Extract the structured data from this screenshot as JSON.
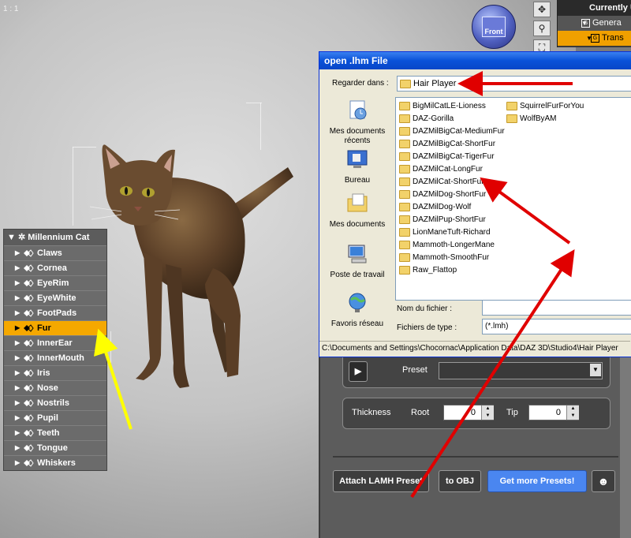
{
  "viewport": {
    "label": "1 : 1",
    "nav_cube_face": "Front"
  },
  "right_panel": {
    "header": "Currently U",
    "rows": [
      {
        "icon": "G",
        "label": "Genera"
      },
      {
        "icon": "G",
        "label": "Trans"
      }
    ]
  },
  "tree": {
    "root": "Millennium Cat",
    "selected": "Fur",
    "items": [
      "Claws",
      "Cornea",
      "EyeRim",
      "EyeWhite",
      "FootPads",
      "Fur",
      "InnerEar",
      "InnerMouth",
      "Iris",
      "Nose",
      "Nostrils",
      "Pupil",
      "Teeth",
      "Tongue",
      "Whiskers"
    ]
  },
  "dialog": {
    "title": "open .lhm File",
    "lookin_label": "Regarder dans :",
    "lookin_value": "Hair Player",
    "places": [
      "Mes documents récents",
      "Bureau",
      "Mes documents",
      "Poste de travail",
      "Favoris réseau"
    ],
    "files_col1": [
      "BigMilCatLE-Lioness",
      "DAZ-Gorilla",
      "DAZMilBigCat-MediumFur",
      "DAZMilBigCat-ShortFur",
      "DAZMilBigCat-TigerFur",
      "DAZMilCat-LongFur",
      "DAZMilCat-ShortFur",
      "DAZMilDog-ShortFur",
      "DAZMilDog-Wolf",
      "DAZMilPup-ShortFur",
      "LionManeTuft-Richard",
      "Mammoth-LongerMane",
      "Mammoth-SmoothFur",
      "Raw_Flattop"
    ],
    "files_col2": [
      "SquirrelFurForYou",
      "WolfByAM"
    ],
    "filename_label": "Nom du fichier :",
    "filename_value": "",
    "filetype_label": "Fichiers de type :",
    "filetype_value": "(*.lmh)",
    "status": "C:\\Documents and Settings\\Chocornac\\Application Data\\DAZ 3D\\Studio4\\Hair Player"
  },
  "hair_panel": {
    "preset_label": "Preset",
    "preset_value": "",
    "thickness_label": "Thickness",
    "root_label": "Root",
    "root_value": "0",
    "tip_label": "Tip",
    "tip_value": "0",
    "attach_button": "Attach LAMH Preset",
    "toobj_button": "to OBJ",
    "more_button": "Get more Presets!"
  },
  "colors": {
    "selection_orange": "#f5a800",
    "annotation_red": "#e00000",
    "annotation_yellow": "#ffff00",
    "blue_button": "#4a86f0"
  }
}
